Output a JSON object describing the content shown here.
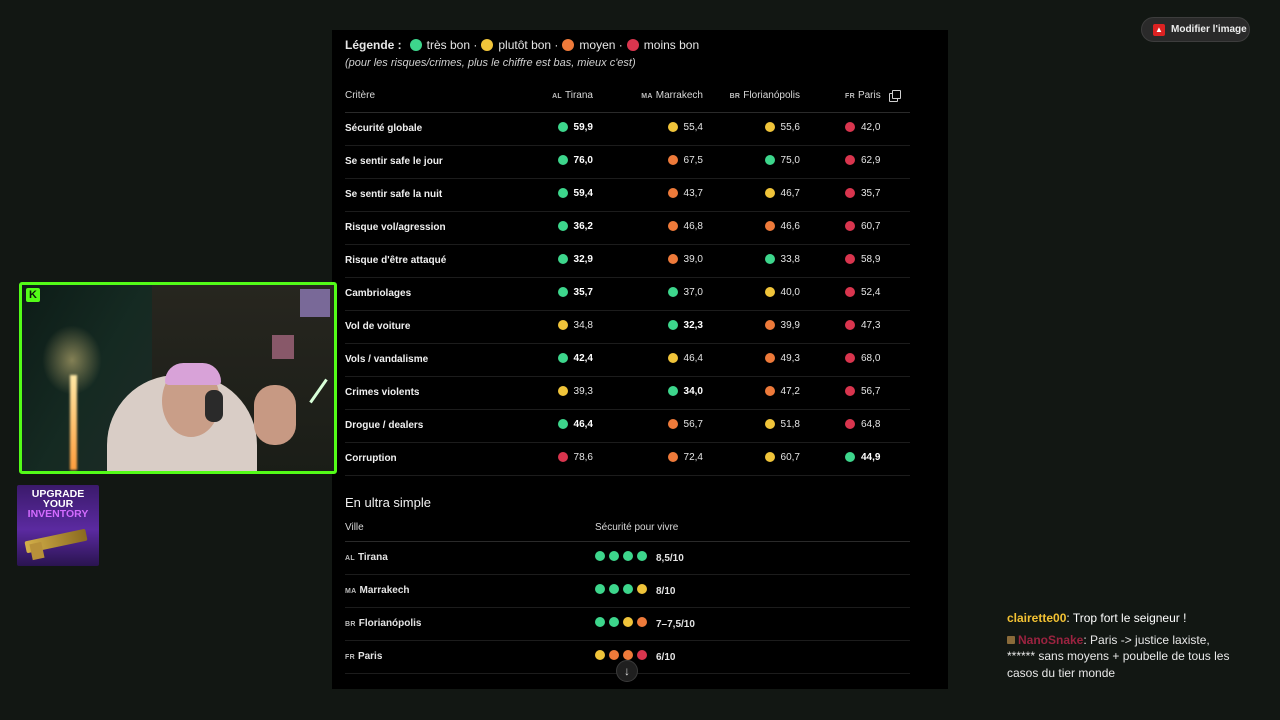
{
  "colors": {
    "tres_bon": "#3dd68c",
    "plutot_bon": "#f0c43a",
    "moyen": "#ee7a3a",
    "moins_bon": "#d9354e",
    "stream_accent": "#53fc18"
  },
  "legend": {
    "label": "Légende :",
    "items": [
      {
        "color": "tres_bon",
        "text": "très bon ·"
      },
      {
        "color": "plutot_bon",
        "text": "plutôt bon ·"
      },
      {
        "color": "moyen",
        "text": "moyen ·"
      },
      {
        "color": "moins_bon",
        "text": "moins bon"
      }
    ],
    "note": "(pour les risques/crimes, plus le chiffre est bas, mieux c'est)"
  },
  "table": {
    "criterion_header": "Critère",
    "cities": [
      {
        "code": "AL",
        "name": "Tirana"
      },
      {
        "code": "MA",
        "name": "Marrakech"
      },
      {
        "code": "BR",
        "name": "Florianópolis"
      },
      {
        "code": "FR",
        "name": "Paris"
      }
    ],
    "rows": [
      {
        "criterion": "Sécurité globale",
        "cells": [
          [
            "tres_bon",
            "59,9",
            true
          ],
          [
            "plutot_bon",
            "55,4",
            false
          ],
          [
            "plutot_bon",
            "55,6",
            false
          ],
          [
            "moins_bon",
            "42,0",
            false
          ]
        ]
      },
      {
        "criterion": "Se sentir safe le jour",
        "cells": [
          [
            "tres_bon",
            "76,0",
            true
          ],
          [
            "moyen",
            "67,5",
            false
          ],
          [
            "tres_bon",
            "75,0",
            false
          ],
          [
            "moins_bon",
            "62,9",
            false
          ]
        ]
      },
      {
        "criterion": "Se sentir safe la nuit",
        "cells": [
          [
            "tres_bon",
            "59,4",
            true
          ],
          [
            "moyen",
            "43,7",
            false
          ],
          [
            "plutot_bon",
            "46,7",
            false
          ],
          [
            "moins_bon",
            "35,7",
            false
          ]
        ]
      },
      {
        "criterion": "Risque vol/agression",
        "cells": [
          [
            "tres_bon",
            "36,2",
            true
          ],
          [
            "moyen",
            "46,8",
            false
          ],
          [
            "moyen",
            "46,6",
            false
          ],
          [
            "moins_bon",
            "60,7",
            false
          ]
        ]
      },
      {
        "criterion": "Risque d'être attaqué",
        "cells": [
          [
            "tres_bon",
            "32,9",
            true
          ],
          [
            "moyen",
            "39,0",
            false
          ],
          [
            "tres_bon",
            "33,8",
            false
          ],
          [
            "moins_bon",
            "58,9",
            false
          ]
        ]
      },
      {
        "criterion": "Cambriolages",
        "cells": [
          [
            "tres_bon",
            "35,7",
            true
          ],
          [
            "tres_bon",
            "37,0",
            false
          ],
          [
            "plutot_bon",
            "40,0",
            false
          ],
          [
            "moins_bon",
            "52,4",
            false
          ]
        ]
      },
      {
        "criterion": "Vol de voiture",
        "cells": [
          [
            "plutot_bon",
            "34,8",
            false
          ],
          [
            "tres_bon",
            "32,3",
            true
          ],
          [
            "moyen",
            "39,9",
            false
          ],
          [
            "moins_bon",
            "47,3",
            false
          ]
        ]
      },
      {
        "criterion": "Vols / vandalisme",
        "cells": [
          [
            "tres_bon",
            "42,4",
            true
          ],
          [
            "plutot_bon",
            "46,4",
            false
          ],
          [
            "moyen",
            "49,3",
            false
          ],
          [
            "moins_bon",
            "68,0",
            false
          ]
        ]
      },
      {
        "criterion": "Crimes violents",
        "cells": [
          [
            "plutot_bon",
            "39,3",
            false
          ],
          [
            "tres_bon",
            "34,0",
            true
          ],
          [
            "moyen",
            "47,2",
            false
          ],
          [
            "moins_bon",
            "56,7",
            false
          ]
        ]
      },
      {
        "criterion": "Drogue / dealers",
        "cells": [
          [
            "tres_bon",
            "46,4",
            true
          ],
          [
            "moyen",
            "56,7",
            false
          ],
          [
            "plutot_bon",
            "51,8",
            false
          ],
          [
            "moins_bon",
            "64,8",
            false
          ]
        ]
      },
      {
        "criterion": "Corruption",
        "cells": [
          [
            "moins_bon",
            "78,6",
            false
          ],
          [
            "moyen",
            "72,4",
            false
          ],
          [
            "plutot_bon",
            "60,7",
            false
          ],
          [
            "tres_bon",
            "44,9",
            true
          ]
        ]
      }
    ]
  },
  "simple": {
    "heading": "En ultra simple",
    "col_city": "Ville",
    "col_security": "Sécurité pour vivre",
    "rows": [
      {
        "code": "AL",
        "city": "Tirana",
        "dots": [
          "tres_bon",
          "tres_bon",
          "tres_bon",
          "tres_bon"
        ],
        "rating": "8,5/10"
      },
      {
        "code": "MA",
        "city": "Marrakech",
        "dots": [
          "tres_bon",
          "tres_bon",
          "tres_bon",
          "plutot_bon"
        ],
        "rating": "8/10"
      },
      {
        "code": "BR",
        "city": "Florianópolis",
        "dots": [
          "tres_bon",
          "tres_bon",
          "plutot_bon",
          "moyen"
        ],
        "rating": "7–7,5/10"
      },
      {
        "code": "FR",
        "city": "Paris",
        "dots": [
          "plutot_bon",
          "moyen",
          "moyen",
          "moins_bon"
        ],
        "rating": "6/10"
      }
    ]
  },
  "toolbar": {
    "modify_label": "Modifier l'image",
    "icon": "pdf-icon"
  },
  "scroll": {
    "icon": "arrow-down-icon",
    "glyph": "↓"
  },
  "webcam": {
    "logo": "K"
  },
  "ad": {
    "line1": "UPGRADE",
    "line2": "YOUR",
    "line3": "INVENTORY"
  },
  "chat": [
    {
      "user": "clairette00",
      "text": ": Trop fort le seigneur !"
    },
    {
      "user": "NanoSnake",
      "text": ": Paris -> justice laxiste, ****** sans moyens + poubelle de tous les casos du tier monde"
    }
  ]
}
